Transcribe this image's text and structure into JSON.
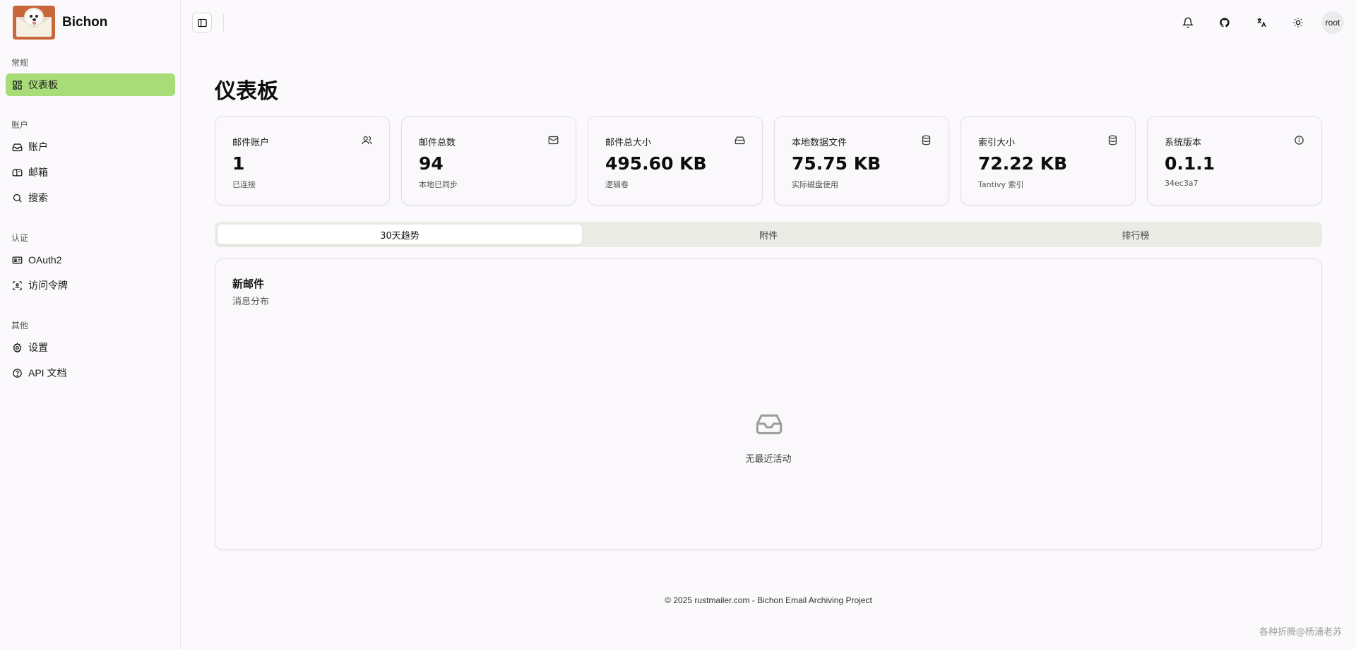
{
  "app": {
    "name": "Bichon"
  },
  "sidebar": {
    "sections": [
      {
        "label": "常规"
      },
      {
        "label": "账户"
      },
      {
        "label": "认证"
      },
      {
        "label": "其他"
      }
    ],
    "items": [
      {
        "label": "仪表板",
        "icon": "dashboard-icon",
        "active": true
      },
      {
        "label": "账户",
        "icon": "inbox-icon"
      },
      {
        "label": "邮箱",
        "icon": "mailbox-icon"
      },
      {
        "label": "搜索",
        "icon": "search-icon"
      },
      {
        "label": "OAuth2",
        "icon": "id-card-icon"
      },
      {
        "label": "访问令牌",
        "icon": "scan-icon"
      },
      {
        "label": "设置",
        "icon": "gear-icon"
      },
      {
        "label": "API 文档",
        "icon": "help-circle-icon"
      }
    ]
  },
  "topbar": {
    "icons": [
      "sidebar-toggle-icon",
      "bell-icon",
      "github-icon",
      "translate-icon",
      "sun-icon"
    ],
    "user": "root"
  },
  "main": {
    "title": "仪表板",
    "stats": [
      {
        "title": "邮件账户",
        "value": "1",
        "sub": "已连接",
        "icon": "users-icon"
      },
      {
        "title": "邮件总数",
        "value": "94",
        "sub": "本地已同步",
        "icon": "mail-icon"
      },
      {
        "title": "邮件总大小",
        "value": "495.60 KB",
        "sub": "逻辑卷",
        "icon": "hard-drive-icon"
      },
      {
        "title": "本地数据文件",
        "value": "75.75 KB",
        "sub": "实际磁盘使用",
        "icon": "database-icon"
      },
      {
        "title": "索引大小",
        "value": "72.22 KB",
        "sub": "Tantivy 索引",
        "icon": "database-icon"
      },
      {
        "title": "系统版本",
        "value": "0.1.1",
        "sub": "34ec3a7",
        "icon": "info-icon"
      }
    ],
    "tabs": [
      {
        "label": "30天趋势",
        "active": true
      },
      {
        "label": "附件"
      },
      {
        "label": "排行榜"
      }
    ],
    "panel": {
      "title": "新邮件",
      "subtitle": "消息分布",
      "empty_text": "无最近活动",
      "empty_icon": "inbox-empty-icon"
    }
  },
  "footer": {
    "text": "© 2025 rustmailer.com - Bichon Email Archiving Project"
  },
  "watermark": "各种折腾@杨浦老苏",
  "colors": {
    "active_nav": "#a8dc78",
    "logo_bg": "#c8683a",
    "tab_bg": "#e9ebe4"
  }
}
